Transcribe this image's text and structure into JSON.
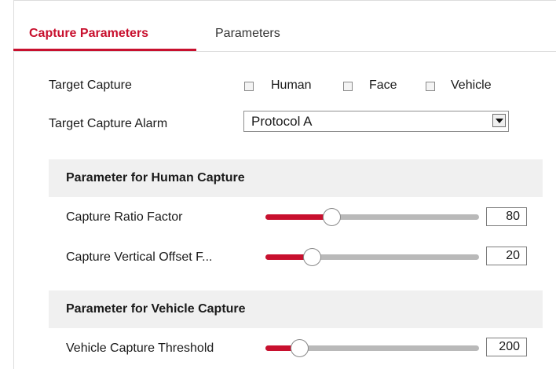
{
  "tabs": [
    {
      "label": "Capture Parameters",
      "active": true
    },
    {
      "label": "Parameters",
      "active": false
    }
  ],
  "target_capture": {
    "label": "Target Capture",
    "options": [
      {
        "label": "Human",
        "checked": false
      },
      {
        "label": "Face",
        "checked": false
      },
      {
        "label": "Vehicle",
        "checked": false
      }
    ]
  },
  "target_capture_alarm": {
    "label": "Target Capture Alarm",
    "selected": "Protocol A"
  },
  "human_section": {
    "title": "Parameter for Human Capture",
    "params": [
      {
        "label": "Capture Ratio Factor",
        "value": "80",
        "fraction": 0.31
      },
      {
        "label": "Capture Vertical Offset F...",
        "value": "20",
        "fraction": 0.22
      }
    ]
  },
  "vehicle_section": {
    "title": "Parameter for Vehicle Capture",
    "params": [
      {
        "label": "Vehicle Capture Threshold",
        "value": "200",
        "fraction": 0.16
      }
    ]
  },
  "colors": {
    "accent": "#c8102e",
    "track": "#b9b9b9",
    "section_bg": "#f0f0f0"
  }
}
